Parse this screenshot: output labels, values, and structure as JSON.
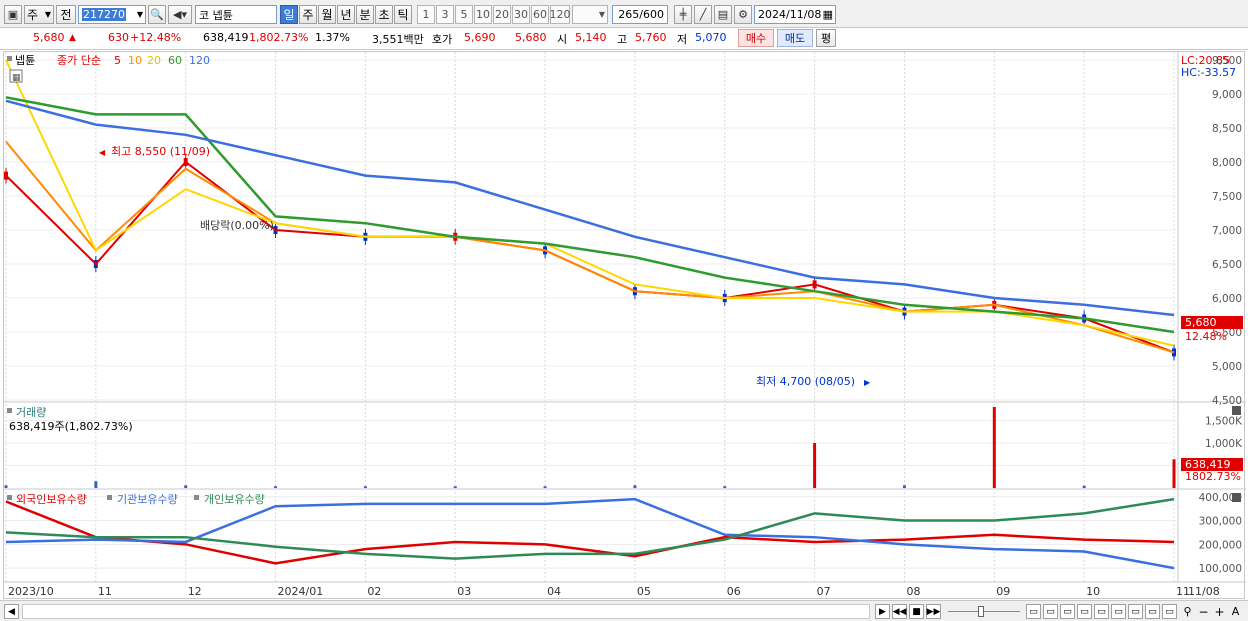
{
  "toolbar": {
    "type_label": "주",
    "prev_label": "전",
    "code_value": "217270",
    "name_value": "넵튠",
    "market_prefix": "코",
    "period_buttons": [
      "일",
      "주",
      "월",
      "년",
      "분",
      "초",
      "틱"
    ],
    "number_buttons": [
      "1",
      "3",
      "5",
      "10",
      "20",
      "30",
      "60",
      "120"
    ],
    "count_value": "265",
    "count_total": "/600",
    "date_value": "2024/11/08"
  },
  "price_row": {
    "price": "5,680",
    "up_arrow": "▲",
    "change": "630",
    "change_pct": "+12.48%",
    "volume": "638,419",
    "volume_ratio": "1,802.73%",
    "turnover": "1.37%",
    "amount": "3,551백만",
    "ask_label": "호가",
    "ask": "5,690",
    "bid": "5,680",
    "open_label": "시",
    "open": "5,140",
    "high_label": "고",
    "high": "5,760",
    "low_label": "저",
    "low": "5,070",
    "buy_label": "매수",
    "sell_label": "매도",
    "avg_label": "평"
  },
  "price_panel": {
    "legend_name": "넵튠",
    "legend_ma_label": "종가 단순",
    "ma_periods": [
      "5",
      "10",
      "20",
      "60",
      "120"
    ],
    "lc": "LC:20.85",
    "hc": "HC:-33.57",
    "y_ticks": [
      "9,500",
      "9,000",
      "8,500",
      "8,000",
      "7,500",
      "7,000",
      "6,500",
      "6,000",
      "5,500",
      "5,000",
      "4,500"
    ],
    "high_annotation": "최고 8,550 (11/09)",
    "low_annotation": "최저 4,700 (08/05)",
    "dividend_annotation": "배당락(0.00%)",
    "last_price_tag": "5,680",
    "last_pct_tag": "12.48%"
  },
  "volume_panel": {
    "title": "거래량",
    "subtitle": "638,419주(1,802.73%)",
    "y_ticks": [
      "1,500K",
      "1,000K",
      "500K"
    ],
    "last_tag": "638,419",
    "last_pct": "1802.73%"
  },
  "holding_panel": {
    "legend": [
      "외국인보유수량",
      "기관보유수량",
      "개인보유수량"
    ],
    "y_ticks": [
      "400,000",
      "300,000",
      "200,000",
      "100,000"
    ]
  },
  "x_axis": {
    "labels": [
      "2023/10",
      "11",
      "12",
      "2024/01",
      "02",
      "03",
      "04",
      "05",
      "06",
      "07",
      "08",
      "09",
      "10",
      "11",
      "11/08"
    ]
  },
  "colors": {
    "ma5": "#e00000",
    "ma10": "#ff8c00",
    "ma20": "#ffd700",
    "ma60": "#2e9b2e",
    "ma120": "#3b6fe0",
    "up": "#e00000",
    "down": "#0033cc"
  },
  "chart_data": [
    {
      "type": "line",
      "title": "넵튠",
      "ylim": [
        4500,
        9500
      ],
      "x": [
        "2023/10",
        "11",
        "12",
        "2024/01",
        "02",
        "03",
        "04",
        "05",
        "06",
        "07",
        "08",
        "09",
        "10",
        "11"
      ],
      "series": [
        {
          "name": "5",
          "values": [
            7800,
            6500,
            8000,
            7000,
            6900,
            6900,
            6700,
            6100,
            6000,
            6200,
            5800,
            5900,
            5700,
            5200
          ]
        },
        {
          "name": "10",
          "values": [
            8300,
            6700,
            7900,
            7100,
            6900,
            6900,
            6700,
            6100,
            6000,
            6100,
            5800,
            5900,
            5600,
            5200
          ]
        },
        {
          "name": "20",
          "values": [
            9500,
            6700,
            7600,
            7100,
            6900,
            6900,
            6800,
            6200,
            6000,
            6000,
            5800,
            5800,
            5600,
            5300
          ]
        },
        {
          "name": "60",
          "values": [
            8950,
            8700,
            8700,
            7200,
            7100,
            6900,
            6800,
            6600,
            6300,
            6100,
            5900,
            5800,
            5700,
            5500
          ]
        },
        {
          "name": "120",
          "values": [
            8900,
            8550,
            8400,
            8100,
            7800,
            7700,
            7300,
            6900,
            6600,
            6300,
            6200,
            6000,
            5900,
            5750
          ]
        }
      ]
    },
    {
      "type": "bar",
      "title": "거래량",
      "ylim": [
        0,
        1800000
      ],
      "x": [
        "2023/10",
        "11",
        "12",
        "2024/01",
        "02",
        "03",
        "04",
        "05",
        "06",
        "07",
        "08",
        "09",
        "10",
        "11"
      ],
      "series": [
        {
          "name": "거래량",
          "values": [
            60000,
            150000,
            60000,
            40000,
            40000,
            40000,
            40000,
            60000,
            40000,
            1000000,
            60000,
            1800000,
            50000,
            638419
          ]
        }
      ]
    },
    {
      "type": "line",
      "title": "",
      "ylim": [
        50000,
        420000
      ],
      "x": [
        "2023/10",
        "11",
        "12",
        "2024/01",
        "02",
        "03",
        "04",
        "05",
        "06",
        "07",
        "08",
        "09",
        "10",
        "11"
      ],
      "series": [
        {
          "name": "외국인보유수량",
          "values": [
            380000,
            230000,
            200000,
            120000,
            180000,
            210000,
            200000,
            150000,
            230000,
            210000,
            220000,
            240000,
            220000,
            210000
          ]
        },
        {
          "name": "기관보유수량",
          "values": [
            210000,
            220000,
            210000,
            360000,
            370000,
            370000,
            370000,
            390000,
            240000,
            230000,
            200000,
            180000,
            170000,
            100000
          ]
        },
        {
          "name": "개인보유수량",
          "values": [
            250000,
            230000,
            230000,
            190000,
            160000,
            140000,
            160000,
            160000,
            220000,
            330000,
            300000,
            300000,
            330000,
            390000
          ]
        }
      ]
    }
  ]
}
